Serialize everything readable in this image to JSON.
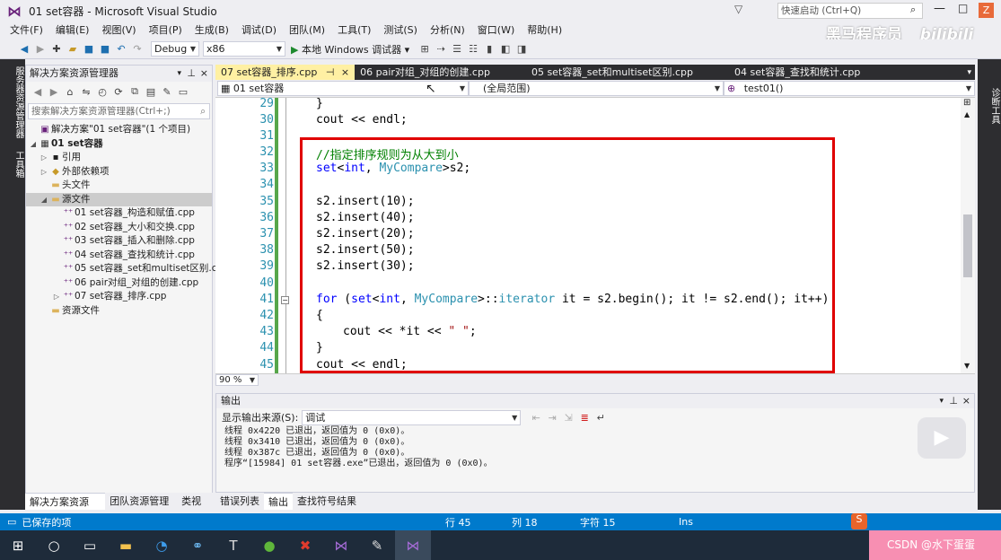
{
  "window": {
    "title": "01 set容器 - Microsoft Visual Studio",
    "quick_launch_placeholder": "快速启动 (Ctrl+Q)"
  },
  "menu": [
    "文件(F)",
    "编辑(E)",
    "视图(V)",
    "项目(P)",
    "生成(B)",
    "调试(D)",
    "团队(M)",
    "工具(T)",
    "测试(S)",
    "分析(N)",
    "窗口(W)",
    "帮助(H)"
  ],
  "toolbar": {
    "config": "Debug",
    "platform": "x86",
    "run_label": "本地 Windows 调试器"
  },
  "watermark": {
    "brand": "黑马程序员",
    "site": "bilibili"
  },
  "left_tabs": [
    "服务器资源管理器",
    "工具箱"
  ],
  "solution_explorer": {
    "title": "解决方案资源管理器",
    "search_placeholder": "搜索解决方案资源管理器(Ctrl+;)",
    "items": [
      {
        "label": "解决方案\"01 set容器\"(1 个项目)",
        "level": 0,
        "icon": "solution-icon"
      },
      {
        "label": "01 set容器",
        "level": 0,
        "icon": "project-icon",
        "bold": true
      },
      {
        "label": "引用",
        "level": 1,
        "icon": "references-icon"
      },
      {
        "label": "外部依赖项",
        "level": 1,
        "icon": "dependencies-icon"
      },
      {
        "label": "头文件",
        "level": 1,
        "icon": "folder-icon"
      },
      {
        "label": "源文件",
        "level": 1,
        "icon": "folder-icon",
        "selected": true
      },
      {
        "label": "01 set容器_构造和赋值.cpp",
        "level": 2,
        "icon": "cpp-file-icon"
      },
      {
        "label": "02 set容器_大小和交换.cpp",
        "level": 2,
        "icon": "cpp-file-icon"
      },
      {
        "label": "03 set容器_插入和删除.cpp",
        "level": 2,
        "icon": "cpp-file-icon"
      },
      {
        "label": "04 set容器_查找和统计.cpp",
        "level": 2,
        "icon": "cpp-file-icon"
      },
      {
        "label": "05 set容器_set和multiset区别.cpp",
        "level": 2,
        "icon": "cpp-file-icon"
      },
      {
        "label": "06 pair对组_对组的创建.cpp",
        "level": 2,
        "icon": "cpp-file-icon"
      },
      {
        "label": "07 set容器_排序.cpp",
        "level": 2,
        "icon": "cpp-file-icon"
      },
      {
        "label": "资源文件",
        "level": 1,
        "icon": "folder-icon"
      }
    ],
    "bottom_tabs": [
      "解决方案资源管...",
      "团队资源管理器",
      "类视图"
    ]
  },
  "doc_tabs": [
    "07 set容器_排序.cpp",
    "06 pair对组_对组的创建.cpp",
    "05 set容器_set和multiset区别.cpp",
    "04 set容器_查找和统计.cpp"
  ],
  "navbar": {
    "project": "01 set容器",
    "scope": "(全局范围)",
    "function": "test01()"
  },
  "editor": {
    "lines": [
      "29",
      "30",
      "31",
      "32",
      "33",
      "34",
      "35",
      "36",
      "37",
      "38",
      "39",
      "40",
      "41",
      "42",
      "43",
      "44",
      "45"
    ],
    "zoom": "90 %"
  },
  "output": {
    "title": "输出",
    "source_label": "显示输出来源(S):",
    "source_value": "调试",
    "lines": [
      "线程 0x4220 已退出，返回值为 0 (0x0)。",
      "线程 0x3410 已退出，返回值为 0 (0x0)。",
      "线程 0x387c 已退出，返回值为 0 (0x0)。",
      "程序“[15984] 01 set容器.exe”已退出，返回值为 0 (0x0)。"
    ],
    "tabs": [
      "错误列表",
      "输出",
      "查找符号结果"
    ]
  },
  "status": {
    "message": "已保存的项",
    "row": "行 45",
    "col": "列 18",
    "char": "字符 15",
    "mode": "Ins"
  },
  "right_tabs": [
    "诊断工具"
  ],
  "csdn": "CSDN @水下蛋蛋"
}
